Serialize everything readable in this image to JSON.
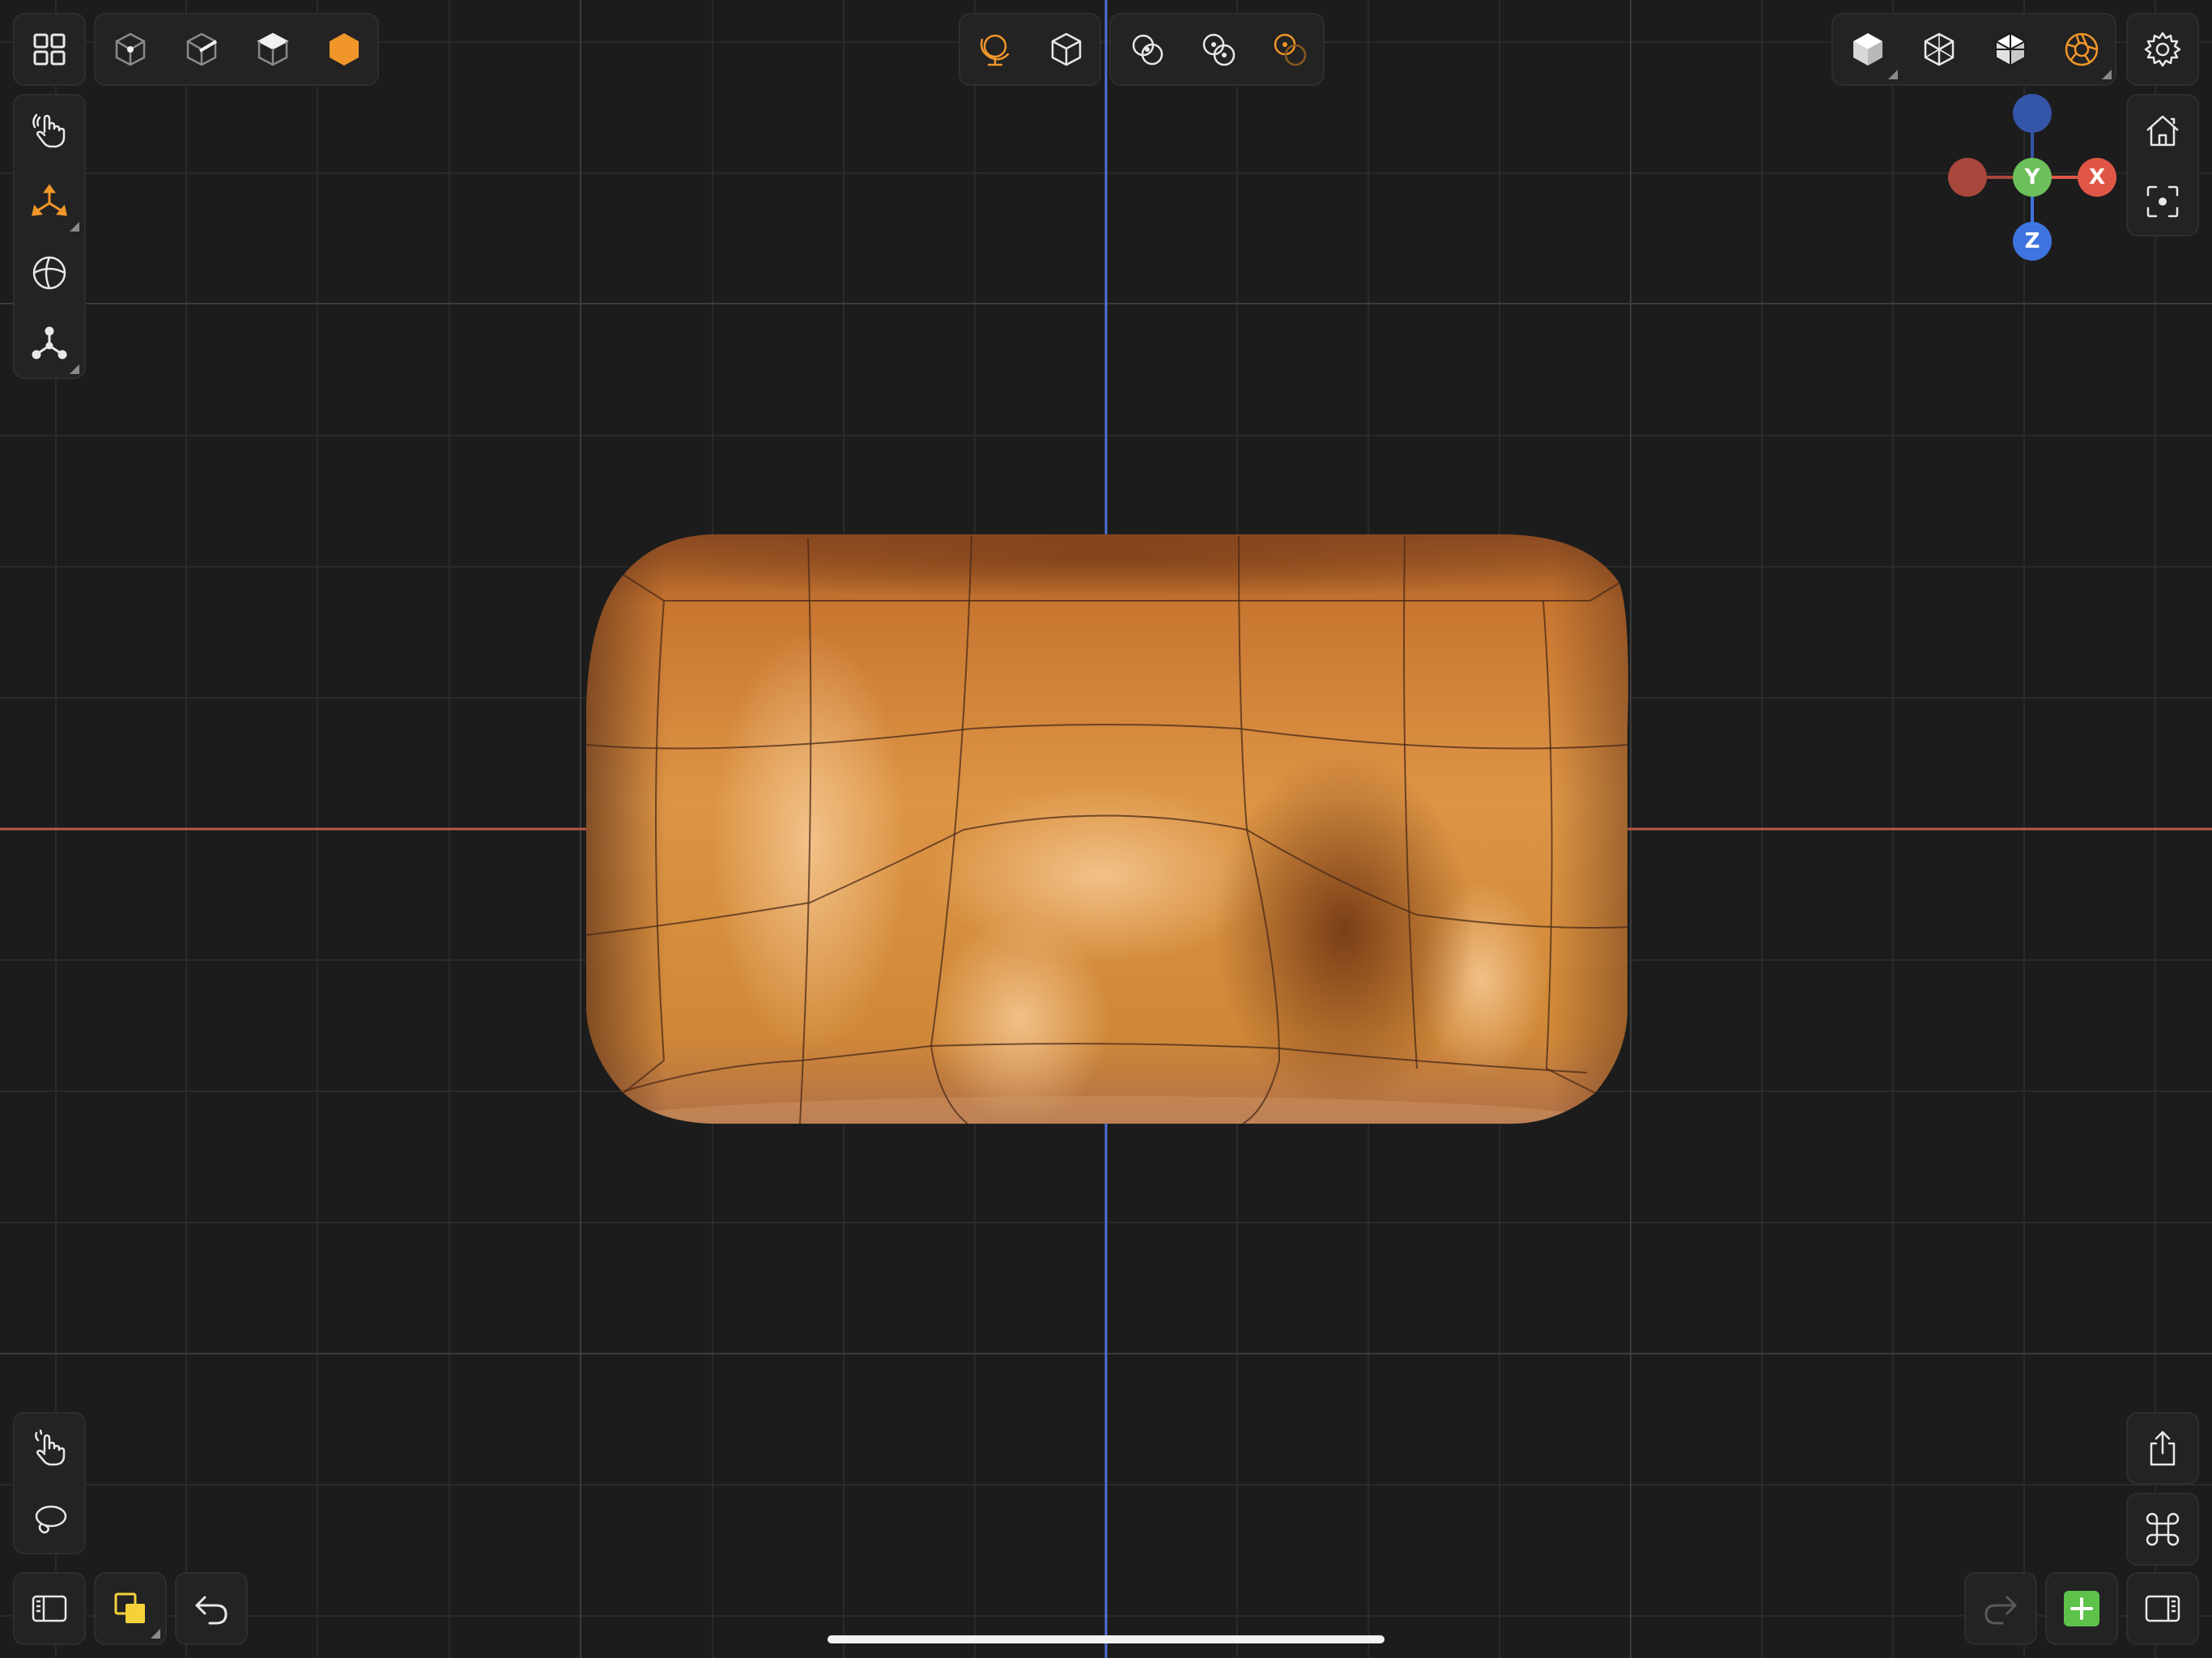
{
  "colors": {
    "background": "#1c1c1c",
    "grid_minor": "#2a2a2a",
    "grid_major": "#3c3c3c",
    "axis_x": "#b85a45",
    "axis_z": "#4e6fd6",
    "accent_orange": "#f0962a",
    "add_green": "#5cc24a",
    "gizmo_x": "#e05646",
    "gizmo_x_neg": "#a8473c",
    "gizmo_y": "#6cbf5a",
    "gizmo_z": "#3f74e0",
    "gizmo_z_neg": "#3555a8"
  },
  "gizmo": {
    "x_label": "X",
    "y_label": "Y",
    "z_label": "Z"
  },
  "toolbars": {
    "top_left": [
      "grid-menu-icon",
      "vertex-mode-icon",
      "edge-mode-icon",
      "face-mode-icon",
      "object-mode-icon"
    ],
    "left": [
      "touch-navigate-icon",
      "transform-gizmo-icon",
      "sphere-mode-icon",
      "pivot-icon"
    ],
    "top_center": [
      "global-orbit-icon",
      "local-cube-icon",
      "snap-off-icon",
      "snap-link-icon",
      "snap-active-icon"
    ],
    "top_right": [
      "solid-shading-icon",
      "wireframe-shading-icon",
      "xray-shading-icon",
      "render-shading-icon",
      "settings-icon"
    ],
    "right": [
      "home-view-icon",
      "frame-selection-icon"
    ],
    "bottom_left": [
      "tap-select-icon",
      "lasso-select-icon",
      "left-panel-icon",
      "layers-icon",
      "undo-icon"
    ],
    "bottom_right": [
      "export-icon",
      "command-icon",
      "redo-icon",
      "add-object-icon",
      "right-panel-icon"
    ]
  }
}
